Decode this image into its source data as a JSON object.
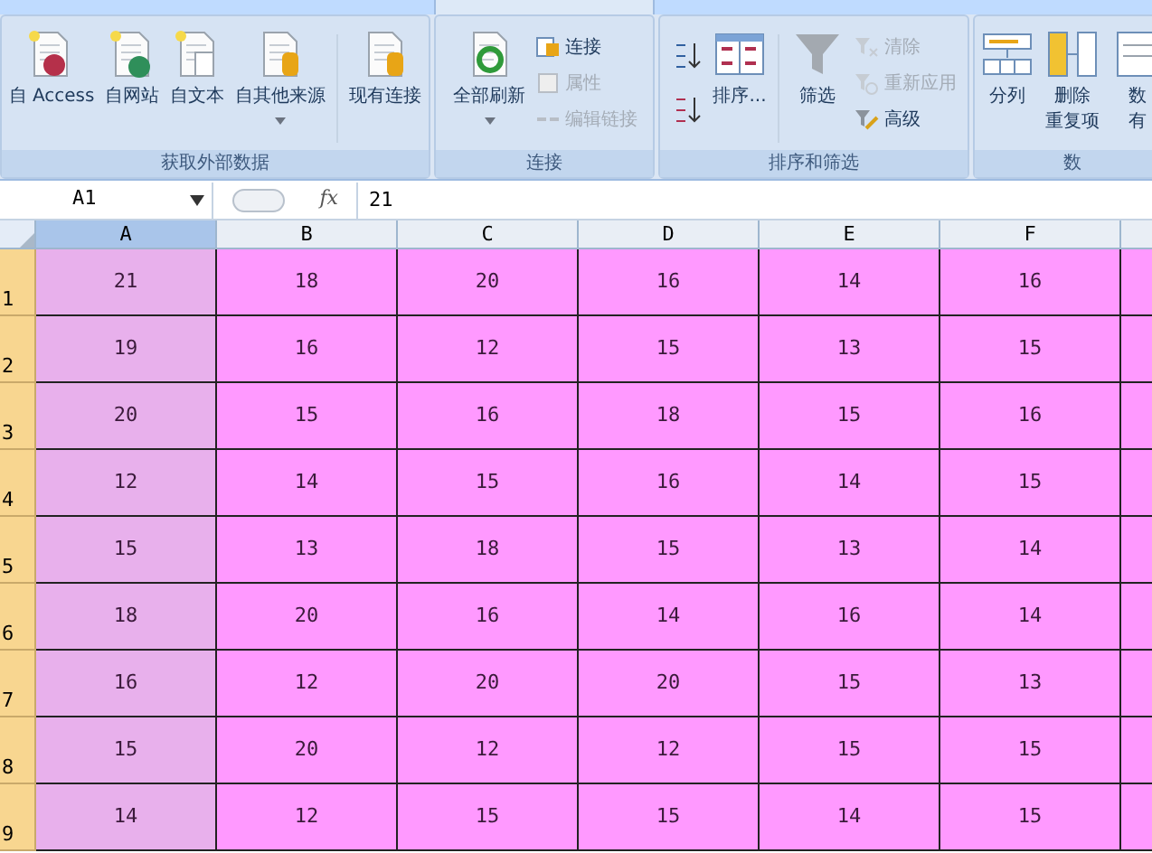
{
  "ribbon": {
    "groups": [
      {
        "label": "获取外部数据",
        "items": [
          {
            "kind": "large",
            "lines": [
              "自 Access"
            ],
            "dropdown": false
          },
          {
            "kind": "large",
            "lines": [
              "自网站"
            ],
            "dropdown": false
          },
          {
            "kind": "large",
            "lines": [
              "自文本"
            ],
            "dropdown": false
          },
          {
            "kind": "large",
            "lines": [
              "自其他来源"
            ],
            "dropdown": true
          },
          {
            "kind": "sep"
          },
          {
            "kind": "large",
            "lines": [
              "现有连接"
            ],
            "dropdown": false
          }
        ]
      },
      {
        "label": "连接",
        "items": [
          {
            "kind": "large",
            "lines": [
              "全部刷新"
            ],
            "dropdown": true
          },
          {
            "kind": "stack",
            "buttons": [
              {
                "label": "连接",
                "disabled": false
              },
              {
                "label": "属性",
                "disabled": true
              },
              {
                "label": "编辑链接",
                "disabled": true
              }
            ]
          }
        ]
      },
      {
        "label": "排序和筛选",
        "items": [
          {
            "kind": "sorticons"
          },
          {
            "kind": "large",
            "lines": [
              "排序..."
            ],
            "dropdown": false
          },
          {
            "kind": "sep"
          },
          {
            "kind": "large",
            "lines": [
              "筛选"
            ],
            "dropdown": false
          },
          {
            "kind": "stack",
            "buttons": [
              {
                "label": "清除",
                "disabled": true
              },
              {
                "label": "重新应用",
                "disabled": true
              },
              {
                "label": "高级",
                "disabled": false
              }
            ]
          }
        ]
      },
      {
        "label": "数",
        "items": [
          {
            "kind": "large",
            "lines": [
              "分列"
            ],
            "dropdown": false
          },
          {
            "kind": "large",
            "lines": [
              "删除",
              "重复项"
            ],
            "dropdown": false
          },
          {
            "kind": "large",
            "lines": [
              "数",
              "有"
            ],
            "dropdown": false
          }
        ]
      }
    ]
  },
  "formula_bar": {
    "name_box": "A1",
    "function_label": "fx",
    "value": "21"
  },
  "sheet": {
    "columns": [
      {
        "label": "A",
        "selected": true
      },
      {
        "label": "B",
        "selected": false
      },
      {
        "label": "C",
        "selected": false
      },
      {
        "label": "D",
        "selected": false
      },
      {
        "label": "E",
        "selected": false
      },
      {
        "label": "F",
        "selected": false
      }
    ],
    "rows": [
      {
        "label": "1",
        "cells": [
          "21",
          "18",
          "20",
          "16",
          "14",
          "16"
        ]
      },
      {
        "label": "2",
        "cells": [
          "19",
          "16",
          "12",
          "15",
          "13",
          "15"
        ]
      },
      {
        "label": "3",
        "cells": [
          "20",
          "15",
          "16",
          "18",
          "15",
          "16"
        ]
      },
      {
        "label": "4",
        "cells": [
          "12",
          "14",
          "15",
          "16",
          "14",
          "15"
        ]
      },
      {
        "label": "5",
        "cells": [
          "15",
          "13",
          "18",
          "15",
          "13",
          "14"
        ]
      },
      {
        "label": "6",
        "cells": [
          "18",
          "20",
          "16",
          "14",
          "16",
          "14"
        ]
      },
      {
        "label": "7",
        "cells": [
          "16",
          "12",
          "20",
          "20",
          "15",
          "13"
        ]
      },
      {
        "label": "8",
        "cells": [
          "15",
          "20",
          "12",
          "12",
          "15",
          "15"
        ]
      },
      {
        "label": "9",
        "cells": [
          "14",
          "12",
          "15",
          "15",
          "14",
          "15"
        ]
      }
    ]
  }
}
